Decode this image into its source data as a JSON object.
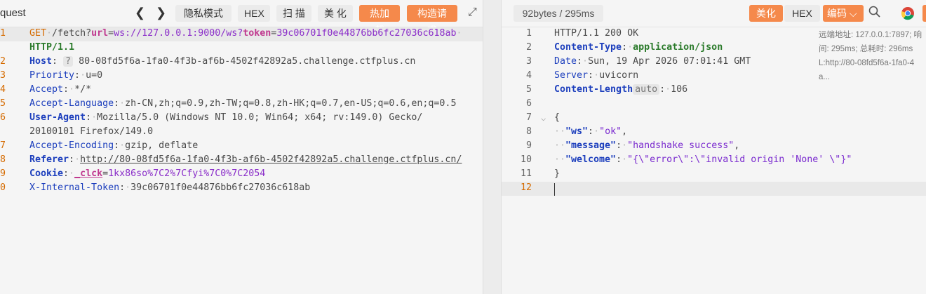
{
  "request": {
    "title": "quest",
    "nav_prev": "❮",
    "nav_next": "❯",
    "buttons": {
      "privacy": "隐私模式",
      "hex": "HEX",
      "scan": "扫 描",
      "beautify": "美 化",
      "hot_load": "热加载",
      "construct": "构造请求"
    },
    "expand_icon": "⤢",
    "line_numbers": [
      "1",
      "",
      "2",
      "3",
      "4",
      "5",
      "6",
      "",
      "7",
      "8",
      "9",
      "0"
    ],
    "lines": {
      "l1_method": "GET",
      "l1_path": "/fetch?",
      "l1_p1": "url",
      "l1_eq1": "=",
      "l1_v1": "ws://127.0.0.1:9000/ws?",
      "l1_p2": "token",
      "l1_eq2": "=",
      "l1_v2": "39c06701f0e44876bb6fc27036c618ab",
      "l1b": "HTTP/1.1",
      "host_key": "Host",
      "host_badge": "?",
      "host_val": "80-08fd5f6a-1fa0-4f3b-af6b-4502f42892a5.challenge.ctfplus.cn",
      "priority_key": "Priority",
      "priority_val": "u=0",
      "accept_key": "Accept",
      "accept_val": "*/*",
      "al_key": "Accept-Language",
      "al_val": "zh-CN,zh;q=0.9,zh-TW;q=0.8,zh-HK;q=0.7,en-US;q=0.6,en;q=0.5",
      "ua_key": "User-Agent",
      "ua_val": "Mozilla/5.0 (Windows NT 10.0; Win64; x64; rv:149.0) Gecko/",
      "ua_val2": "20100101 Firefox/149.0",
      "ae_key": "Accept-Encoding",
      "ae_val": "gzip, deflate",
      "ref_key": "Referer",
      "ref_val": "http://80-08fd5f6a-1fa0-4f3b-af6b-4502f42892a5.challenge.ctfplus.cn/",
      "cookie_key": "Cookie",
      "cookie_name": "_clck",
      "cookie_eq": "=",
      "cookie_val": "1kx86so%7C2%7Cfyi%7C0%7C2054",
      "xit_key": "X-Internal-Token",
      "xit_val": "39c06701f0e44876bb6fc27036c618ab"
    }
  },
  "response": {
    "stats": "92bytes / 295ms",
    "buttons": {
      "beautify": "美化",
      "hex": "HEX",
      "encode": "编码"
    },
    "chevron": "⌵",
    "line_numbers": [
      "1",
      "2",
      "3",
      "4",
      "5",
      "6",
      "7",
      "8",
      "9",
      "10",
      "11",
      "12"
    ],
    "lines": {
      "status": "HTTP/1.1 200 OK",
      "ct_key": "Content-Type",
      "ct_val": "application/json",
      "date_key": "Date",
      "date_val": "Sun, 19 Apr 2026 07:01:41 GMT",
      "server_key": "Server",
      "server_val": "uvicorn",
      "cl_key": "Content-Length",
      "cl_badge": "auto",
      "cl_val": "106",
      "brace_open": "{",
      "ws_key": "\"ws\"",
      "ws_val": "\"ok\"",
      "msg_key": "\"message\"",
      "msg_val": "\"handshake success\"",
      "welcome_key": "\"welcome\"",
      "welcome_val": "\"{\\\"error\\\":\\\"invalid origin 'None' \\\"}\"",
      "brace_close": "}"
    },
    "side_info": {
      "line1": "远端地址: 127.0.0.1:7897; 响",
      "line2": "间: 295ms; 总耗时: 296ms",
      "line3": "L:http://80-08fd5f6a-1fa0-4",
      "line4": "a..."
    }
  }
}
